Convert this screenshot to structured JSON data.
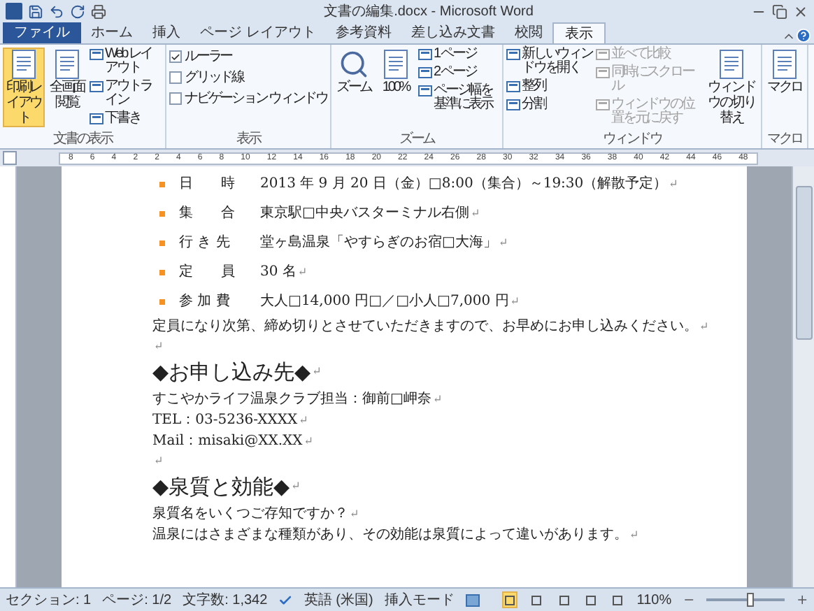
{
  "window": {
    "title": "文書の編集.docx - Microsoft Word"
  },
  "file_button": {
    "label": "ファイル"
  },
  "tabs": [
    {
      "label": "ホーム",
      "selected": false
    },
    {
      "label": "挿入",
      "selected": false
    },
    {
      "label": "ページ レイアウト",
      "selected": false
    },
    {
      "label": "参考資料",
      "selected": false
    },
    {
      "label": "差し込み文書",
      "selected": false
    },
    {
      "label": "校閲",
      "selected": false
    },
    {
      "label": "表示",
      "selected": true
    }
  ],
  "ribbon": {
    "groups": [
      {
        "label": "文書の表示",
        "big": [
          {
            "label": "印刷レイアウト",
            "selected": true
          },
          {
            "label": "全画面閲覧",
            "selected": false
          }
        ],
        "small": [
          {
            "label": "Web レイアウト",
            "disabled": false
          },
          {
            "label": "アウトライン",
            "disabled": false
          },
          {
            "label": "下書き",
            "disabled": false
          }
        ]
      },
      {
        "label": "表示",
        "checks": [
          {
            "label": "ルーラー",
            "checked": true
          },
          {
            "label": "グリッド線",
            "checked": false
          },
          {
            "label": "ナビゲーション ウィンドウ",
            "checked": false
          }
        ]
      },
      {
        "label": "ズーム",
        "big": [
          {
            "label": "ズーム",
            "selected": false
          },
          {
            "label": "100%",
            "selected": false
          }
        ],
        "small": [
          {
            "label": "1 ページ",
            "disabled": false
          },
          {
            "label": "2 ページ",
            "disabled": false
          },
          {
            "label": "ページ幅を基準に表示",
            "disabled": false
          }
        ]
      },
      {
        "label": "ウィンドウ",
        "small": [
          {
            "label": "新しいウィンドウを開く",
            "disabled": false
          },
          {
            "label": "整列",
            "disabled": false
          },
          {
            "label": "分割",
            "disabled": false
          },
          {
            "label": "並べて比較",
            "disabled": true
          },
          {
            "label": "同時にスクロール",
            "disabled": true
          },
          {
            "label": "ウィンドウの位置を元に戻す",
            "disabled": true
          }
        ],
        "after": [
          {
            "label": "ウィンドウの切り替え",
            "selected": false
          }
        ]
      },
      {
        "label": "マクロ",
        "big": [
          {
            "label": "マクロ",
            "selected": false
          }
        ]
      }
    ]
  },
  "ruler": {
    "labels": [
      "8",
      "6",
      "4",
      "2",
      "2",
      "4",
      "6",
      "8",
      "10",
      "12",
      "14",
      "16",
      "18",
      "20",
      "22",
      "24",
      "26",
      "28",
      "30",
      "32",
      "34",
      "36",
      "38",
      "40",
      "42",
      "44",
      "46",
      "48"
    ]
  },
  "document": {
    "end_mark": "↵",
    "bullets": [
      {
        "label": "日　　時",
        "value": "2013 年 9 月 20 日（金）□8:00（集合）～19:30（解散予定）"
      },
      {
        "label": "集　　合",
        "value": "東京駅□中央バスターミナル右側"
      },
      {
        "label": "行 き 先",
        "value": "堂ヶ島温泉「やすらぎのお宿□大海」"
      },
      {
        "label": "定　　員",
        "value": "30 名"
      },
      {
        "label": "参 加 費",
        "value": "大人□14,000 円□／□小人□7,000 円"
      }
    ],
    "blocks": [
      {
        "kind": "text",
        "text": "定員になり次第、締め切りとさせていただきますので、お早めにお申し込みください。"
      },
      {
        "kind": "empty"
      },
      {
        "kind": "heading",
        "text": "◆お申し込み先◆"
      },
      {
        "kind": "text",
        "text": "すこやかライフ温泉クラブ担当：御前□岬奈"
      },
      {
        "kind": "text",
        "text": "TEL：03-5236-XXXX"
      },
      {
        "kind": "text",
        "text": "Mail：misaki@XX.XX"
      },
      {
        "kind": "empty"
      },
      {
        "kind": "heading",
        "text": "◆泉質と効能◆"
      },
      {
        "kind": "text",
        "text": "泉質名をいくつご存知ですか？"
      },
      {
        "kind": "text",
        "text": "温泉にはさまざまな種類があり、その効能は泉質によって違いがあります。"
      }
    ]
  },
  "status_bar": {
    "items": [
      "セクション: 1",
      "ページ: 1/2",
      "文字数: 1,342"
    ],
    "language": "英語 (米国)",
    "mode": "挿入モード",
    "views": [
      {
        "selected": true
      },
      {
        "selected": false
      },
      {
        "selected": false
      },
      {
        "selected": false
      },
      {
        "selected": false
      }
    ],
    "zoom": "110%",
    "zoom_slider": {
      "level": 0.52
    }
  }
}
